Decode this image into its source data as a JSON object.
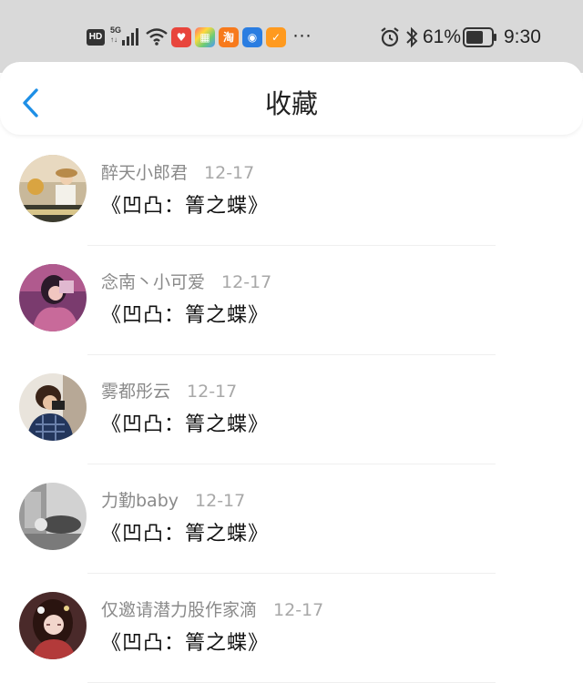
{
  "status_bar": {
    "network_badge": "HD",
    "network_type": "5G",
    "battery_percent": "61%",
    "time": "9:30",
    "more": "···",
    "app_icons": [
      {
        "name": "taobao-app-icon",
        "glyph": "淘",
        "color": "#f77a1c"
      },
      {
        "name": "app-icon-red",
        "glyph": "♥",
        "color": "#e8453c"
      },
      {
        "name": "app-icon-multicolor",
        "glyph": "▦",
        "color": "#5b7df0"
      },
      {
        "name": "bulb-app-icon",
        "glyph": "◉",
        "color": "#2a7de1"
      },
      {
        "name": "app-icon-orange",
        "glyph": "✓",
        "color": "#ff9a1f"
      }
    ]
  },
  "header": {
    "title": "收藏",
    "back_icon": "chevron-left-icon",
    "accent_color": "#1e8fe6"
  },
  "favorites": [
    {
      "username": "醉天小郎君",
      "date": "12-17",
      "title": "《凹凸：箐之蝶》"
    },
    {
      "username": "念南丶小可爱",
      "date": "12-17",
      "title": "《凹凸：箐之蝶》"
    },
    {
      "username": "雾都彤云",
      "date": "12-17",
      "title": "《凹凸：箐之蝶》"
    },
    {
      "username": "力勤baby",
      "date": "12-17",
      "title": "《凹凸：箐之蝶》"
    },
    {
      "username": "仅邀请潜力股作家滴",
      "date": "12-17",
      "title": "《凹凸：箐之蝶》"
    }
  ]
}
